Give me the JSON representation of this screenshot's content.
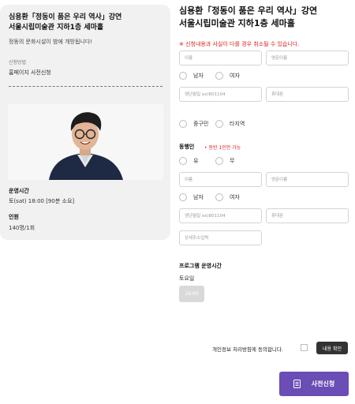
{
  "event": {
    "title_line1": "심용환「정동이 품은 우리 역사」강연",
    "title_line2": "서울시립미술관 지하1층 세마홀",
    "description": "정동의 문화시설이 밤에 개방됩니다!",
    "method_label": "신청방법",
    "method_value": "홈페이지 사전신청",
    "time_label": "운영시간",
    "time_value": "토(sat) 18:00 [90분 소요]",
    "capacity_label": "인원",
    "capacity_value": "140명/1회"
  },
  "form": {
    "title_line1": "심용환「정동이 품은 우리 역사」강연",
    "title_line2": "서울시립미술관 지하1층 세마홀",
    "warning": "※ 신청내용과 사실이 다를 경우 취소될 수 있습니다.",
    "name_placeholder": "이름",
    "eng_name_placeholder": "영문이름",
    "gender_male": "남자",
    "gender_female": "여자",
    "birth_placeholder": "생년월일 ex)801104",
    "phone_placeholder": "휴대폰",
    "region_1": "중구민",
    "region_2": "타지역",
    "companion_label": "동행인",
    "companion_note": "• 동반 1인만 가능",
    "companion_yes": "유",
    "companion_no": "무",
    "companion_name_placeholder": "이름",
    "companion_eng_name_placeholder": "영문이름",
    "companion_gender_male": "남자",
    "companion_gender_female": "여자",
    "companion_birth_placeholder": "생년월일 ex)801104",
    "companion_phone_placeholder": "휴대폰",
    "address_placeholder": "상세주소입력",
    "program_label": "프로그램 운영시간",
    "program_day": "토요일",
    "program_time": "18:00",
    "agree_text": "개인정보 처리방침에 동의합니다.",
    "content_button": "내용 확인",
    "submit_button": "사전신청"
  },
  "colors": {
    "accent": "#6a4db5",
    "warning": "#e02020",
    "card_bg": "#f1f1f1"
  }
}
